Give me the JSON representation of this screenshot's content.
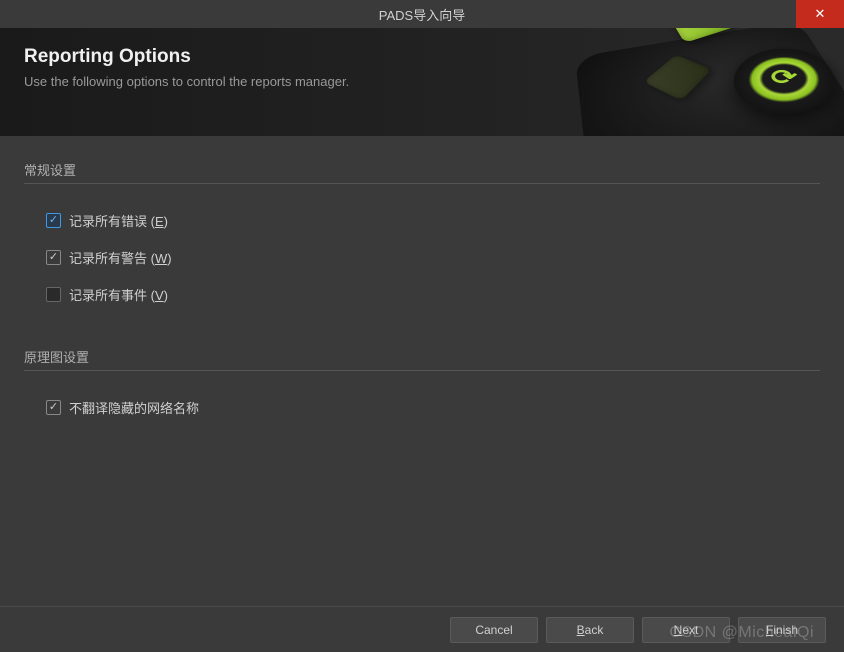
{
  "window": {
    "title": "PADS导入向导"
  },
  "header": {
    "title": "Reporting Options",
    "subtitle": "Use the following options to control the reports manager."
  },
  "sections": {
    "general": {
      "label": "常规设置",
      "options": [
        {
          "label": "记录所有错误 (E)",
          "accelerator": "E",
          "checked": true,
          "highlight": true
        },
        {
          "label": "记录所有警告 (W)",
          "accelerator": "W",
          "checked": true,
          "highlight": false
        },
        {
          "label": "记录所有事件 (V)",
          "accelerator": "V",
          "checked": false,
          "highlight": false
        }
      ]
    },
    "schematic": {
      "label": "原理图设置",
      "options": [
        {
          "label": "不翻译隐藏的网络名称",
          "checked": true,
          "highlight": false
        }
      ]
    }
  },
  "footer": {
    "cancel": "Cancel",
    "back": "Back",
    "next": "Next",
    "finish": "Finish"
  },
  "watermark": "CSDN @MichealQi",
  "colors": {
    "accent_green": "#a8d838",
    "close_red": "#c42b1c",
    "background": "#3a3a3a"
  }
}
